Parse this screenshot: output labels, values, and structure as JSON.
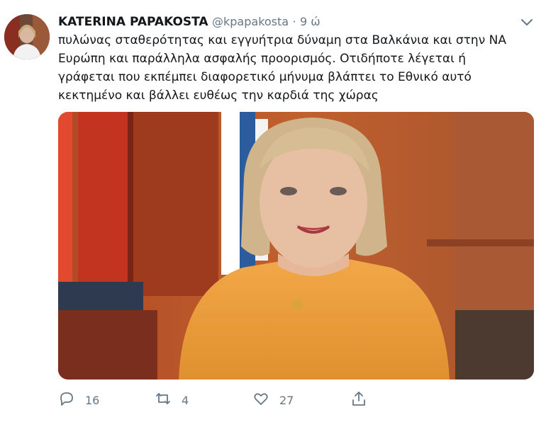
{
  "tweet": {
    "author_name": "KATERINA PAPAKOSTA",
    "handle": "@kpapakosta",
    "separator": "·",
    "time": "9 ώ",
    "lines": [
      "πυλώνας σταθερότητας και εγγυήτρια δύναμη στα Βαλκάνια και στην ΝΑ",
      "Ευρώπη και παράλληλα ασφαλής προορισμός. Οτιδήποτε λέγεται ή",
      "γράφεται που εκπέμπει διαφορετικό μήνυμα βλάπτει το Εθνικό αυτό",
      "κεκτημένο  και βάλλει  ευθέως την καρδιά της χώρας"
    ]
  },
  "actions": {
    "reply_count": "16",
    "retweet_count": "4",
    "like_count": "27"
  },
  "icons": {
    "reply": "reply-icon",
    "retweet": "retweet-icon",
    "like": "heart-icon",
    "share": "share-icon",
    "more": "chevron-down-icon"
  },
  "colors": {
    "secondary_text": "#657786",
    "primary_text": "#14171a"
  }
}
